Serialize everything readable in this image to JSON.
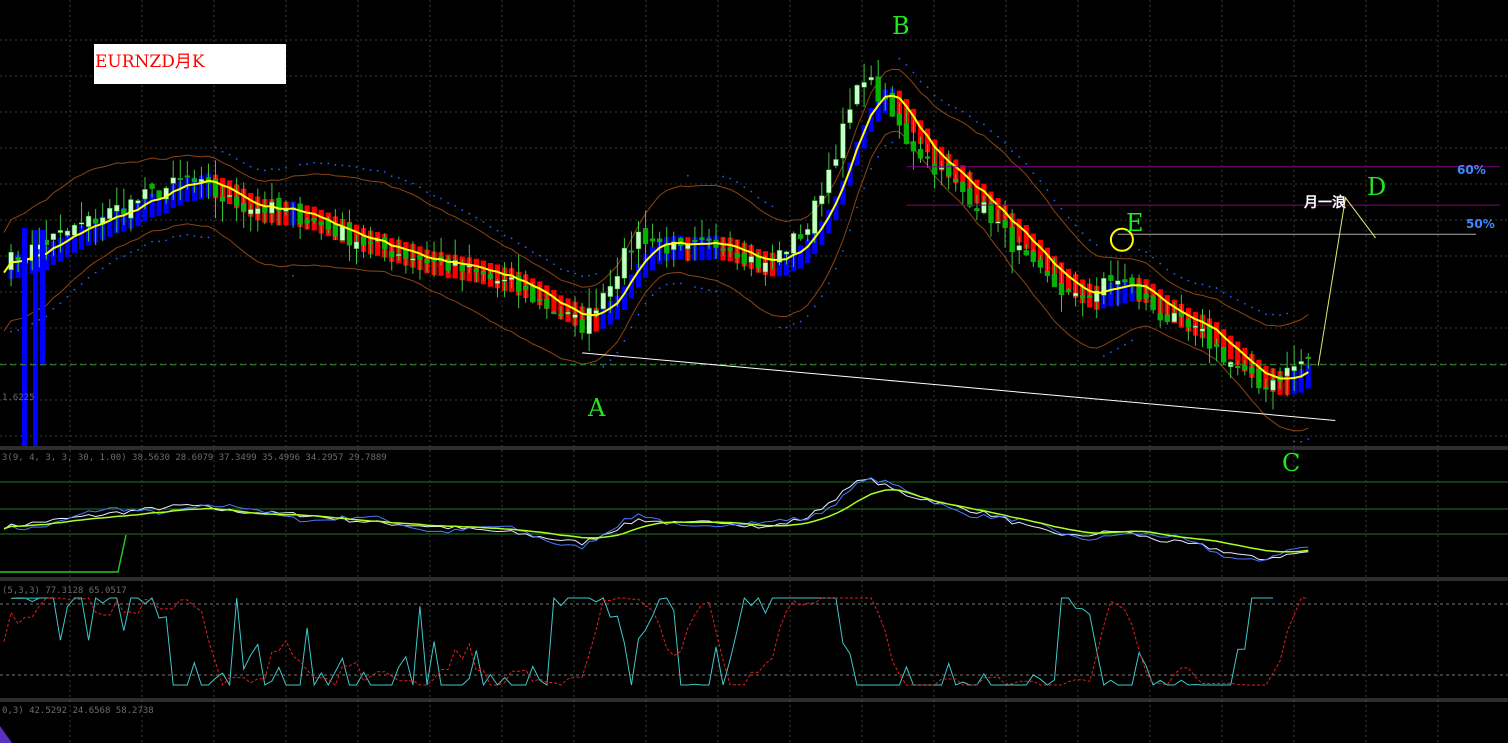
{
  "chart_data": [
    {
      "type": "candlestick",
      "title": "EURNZD月K",
      "wave_labels": [
        {
          "label": "A",
          "bar": 82,
          "price": 1.58
        },
        {
          "label": "B",
          "bar": 120,
          "price": 2.55
        },
        {
          "label": "C",
          "bar": 178,
          "price": 1.52
        },
        {
          "label": "D",
          "bar": 190,
          "price": 2.11
        },
        {
          "label": "E",
          "bar": 158,
          "price": 2.08
        }
      ],
      "annotation": "月一浪",
      "fib_levels": [
        {
          "label": "60%",
          "price": 2.165
        },
        {
          "label": "50%",
          "price": 2.06
        }
      ],
      "resistance_line_price": 1.98,
      "support_line": {
        "from": {
          "bar": 82,
          "price": 1.655
        },
        "to": {
          "bar": 186,
          "price": 1.47
        }
      },
      "current_level_label": "1.6225",
      "current_level_price": 1.6225,
      "anchors": [
        {
          "bar": 0,
          "price": 1.9
        },
        {
          "bar": 6,
          "price": 1.96
        },
        {
          "bar": 16,
          "price": 2.05
        },
        {
          "bar": 26,
          "price": 2.13
        },
        {
          "bar": 32,
          "price": 2.07
        },
        {
          "bar": 42,
          "price": 2.03
        },
        {
          "bar": 52,
          "price": 1.95
        },
        {
          "bar": 62,
          "price": 1.9
        },
        {
          "bar": 72,
          "price": 1.84
        },
        {
          "bar": 82,
          "price": 1.73
        },
        {
          "bar": 90,
          "price": 1.98
        },
        {
          "bar": 96,
          "price": 1.93
        },
        {
          "bar": 102,
          "price": 1.96
        },
        {
          "bar": 108,
          "price": 1.89
        },
        {
          "bar": 114,
          "price": 2.0
        },
        {
          "bar": 122,
          "price": 2.42
        },
        {
          "bar": 128,
          "price": 2.24
        },
        {
          "bar": 134,
          "price": 2.13
        },
        {
          "bar": 140,
          "price": 2.03
        },
        {
          "bar": 146,
          "price": 1.88
        },
        {
          "bar": 152,
          "price": 1.8
        },
        {
          "bar": 158,
          "price": 1.86
        },
        {
          "bar": 164,
          "price": 1.76
        },
        {
          "bar": 170,
          "price": 1.7
        },
        {
          "bar": 178,
          "price": 1.56
        },
        {
          "bar": 185,
          "price": 1.64
        }
      ],
      "bars": 186,
      "ylim": [
        1.4,
        2.6
      ],
      "indicator_1_label": "3(9, 4, 3, 3, 30, 1.00) 38.5630 28.6079 37.3499 35.4996 34.2957 29.7889",
      "indicator_2_label": "(5,3,3) 77.3128 65.0517",
      "indicator_3_label": "0,3) 42.5292 24.6568 58.2738",
      "colors": {
        "up": "#c8ffc8",
        "down": "#00b400",
        "bull_bar": "#0000ff",
        "bear_bar": "#ff0000",
        "ma": "#ffff00",
        "band": "#8b4513",
        "sar": "#2060ff",
        "fib": "#800080",
        "grid": "#3a3a3a"
      }
    }
  ]
}
